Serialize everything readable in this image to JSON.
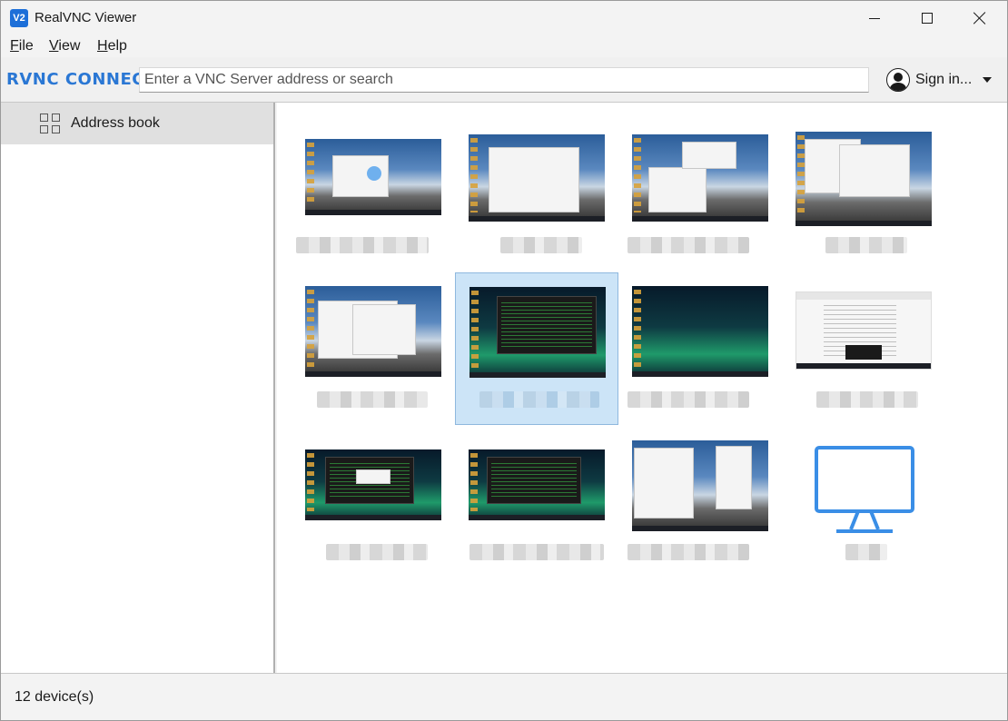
{
  "window": {
    "title": "RealVNC Viewer",
    "app_icon_glyph": "V2"
  },
  "menu": {
    "file": "File",
    "view": "View",
    "help": "Help"
  },
  "toolbar": {
    "brand": "RVNC CONNECT",
    "search_placeholder": "Enter a VNC Server address or search",
    "signin_label": "Sign in..."
  },
  "sidebar": {
    "items": [
      {
        "label": "Address book",
        "icon": "grid-icon"
      }
    ]
  },
  "devices": [
    {
      "thumbnail": "mountain-dialog",
      "selected": false
    },
    {
      "thumbnail": "mountain-explorer",
      "selected": false
    },
    {
      "thumbnail": "mountain-editor",
      "selected": false
    },
    {
      "thumbnail": "mountain-settings",
      "selected": false
    },
    {
      "thumbnail": "mountain-settings-2",
      "selected": false
    },
    {
      "thumbnail": "aurora-terminal",
      "selected": true
    },
    {
      "thumbnail": "aurora-desktop",
      "selected": false
    },
    {
      "thumbnail": "browser-document",
      "selected": false
    },
    {
      "thumbnail": "aurora-terminal-dialog",
      "selected": false
    },
    {
      "thumbnail": "aurora-terminal-2",
      "selected": false
    },
    {
      "thumbnail": "mountain-chat",
      "selected": false
    },
    {
      "thumbnail": "no-preview-monitor",
      "selected": false
    }
  ],
  "status": {
    "text": "12 device(s)"
  },
  "colors": {
    "accent": "#2a77d4",
    "selection": "#cce4f7",
    "monitor_icon": "#3a8ee6"
  }
}
